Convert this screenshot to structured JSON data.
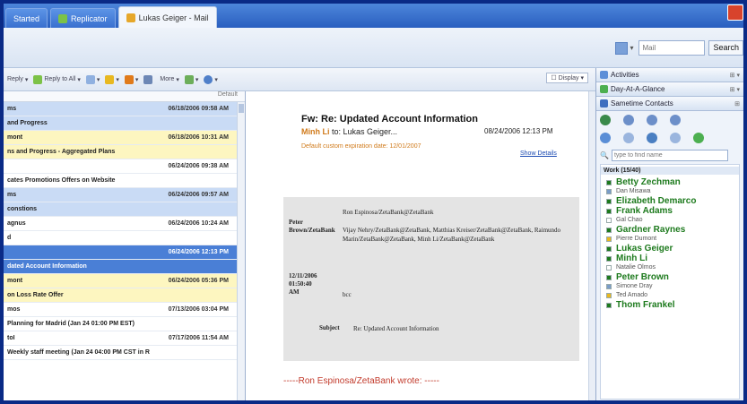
{
  "tabs": [
    {
      "label": "Started",
      "color": "#3a70cf"
    },
    {
      "label": "Replicator",
      "color": "#7cc247"
    },
    {
      "label": "Lukas Geiger - Mail",
      "color": "#e6a72a"
    }
  ],
  "search": {
    "scope": "Mail",
    "button_label": "Search"
  },
  "toolbar": {
    "reply": "Reply",
    "reply_to_all": "Reply to All",
    "more": "More",
    "display": "Display"
  },
  "list": {
    "header_right": "Default",
    "rows": [
      {
        "kind": "msg",
        "from": "ms",
        "date": "06/18/2006 09:58 AM",
        "style": "blue"
      },
      {
        "kind": "subject",
        "text": "and Progress",
        "style": "blue"
      },
      {
        "kind": "msg",
        "from": "mont",
        "date": "06/18/2006 10:31 AM",
        "style": "yellow"
      },
      {
        "kind": "subject",
        "text": "ns and Progress - Aggregated Plans",
        "style": "yellow"
      },
      {
        "kind": "msg",
        "from": "",
        "date": "06/24/2006 09:38 AM",
        "style": ""
      },
      {
        "kind": "subject",
        "text": "cates Promotions Offers on Website",
        "style": ""
      },
      {
        "kind": "msg",
        "from": "ms",
        "date": "06/24/2006 09:57 AM",
        "style": "blue"
      },
      {
        "kind": "subject",
        "text": "constions",
        "style": "blue"
      },
      {
        "kind": "msg",
        "from": "agnus",
        "date": "06/24/2006 10:24 AM",
        "style": ""
      },
      {
        "kind": "subject",
        "text": "d",
        "style": ""
      },
      {
        "kind": "msg",
        "from": "",
        "date": "06/24/2006 12:13 PM",
        "style": "sel"
      },
      {
        "kind": "subject",
        "text": "dated Account Information",
        "style": "sel"
      },
      {
        "kind": "msg",
        "from": "mont",
        "date": "06/24/2006 05:36 PM",
        "style": "yellow"
      },
      {
        "kind": "subject",
        "text": "on Loss Rate Offer",
        "style": "yellow"
      },
      {
        "kind": "msg",
        "from": "mos",
        "date": "07/13/2006 03:04 PM",
        "style": ""
      },
      {
        "kind": "subject",
        "text": "Planning for Madrid (Jan 24 01:00 PM EST)",
        "style": ""
      },
      {
        "kind": "msg",
        "from": "tol",
        "date": "07/17/2006 11:54 AM",
        "style": ""
      },
      {
        "kind": "subject",
        "text": "Weekly staff meeting (Jan 24 04:00 PM CST in R",
        "style": ""
      }
    ]
  },
  "message": {
    "subject": "Fw: Re: Updated Account Information",
    "from_name": "Minh Li",
    "to_text": "to: Lukas Geiger...",
    "date": "08/24/2006 12:13 PM",
    "expiration": "Default custom expiration date: 12/01/2007",
    "show_details": "Show Details",
    "memo": {
      "sender_label": "Peter Brown/ZetaBank",
      "to": "Ron Espinosa/ZetaBank@ZetaBank",
      "cc": "Vijay Nehry/ZetaBank@ZetaBank, Matthias Kreiser/ZetaBank@ZetaBank, Raimundo Marin/ZetaBank@ZetaBank, Minh Li/ZetaBank@ZetaBank",
      "date_label": "12/11/2006 01:50:40 AM",
      "bcc_label": "bcc",
      "subject_label": "Subject",
      "subject": "Re: Updated Account Information"
    },
    "wrote": "-----Ron Espinosa/ZetaBank wrote: -----"
  },
  "sidebar": {
    "activities": "Activities",
    "day_at_a_glance": "Day-At-A-Glance",
    "sametime": "Sametime Contacts",
    "find_placeholder": "type to find name",
    "group": "Work (15/40)",
    "contacts": [
      {
        "name": "Betty Zechman",
        "status": "online",
        "color": "#1d7a1d"
      },
      {
        "name": "Dan Misawa",
        "status": "small",
        "color": "#7a9cc8"
      },
      {
        "name": "Elizabeth Demarco",
        "status": "online",
        "color": "#1d7a1d"
      },
      {
        "name": "Frank Adams",
        "status": "online",
        "color": "#1d7a1d"
      },
      {
        "name": "Gal Chao",
        "status": "small",
        "color": "#ffffff"
      },
      {
        "name": "Gardner Raynes",
        "status": "online",
        "color": "#1d7a1d"
      },
      {
        "name": "Pierre Dumont",
        "status": "small",
        "color": "#e8b820"
      },
      {
        "name": "Lukas Geiger",
        "status": "online",
        "color": "#1d7a1d"
      },
      {
        "name": "Minh Li",
        "status": "online",
        "color": "#1d7a1d"
      },
      {
        "name": "Natalie Olmos",
        "status": "small",
        "color": "#ffffff"
      },
      {
        "name": "Peter Brown",
        "status": "online",
        "color": "#1d7a1d"
      },
      {
        "name": "Simone Dray",
        "status": "small",
        "color": "#7a9cc8"
      },
      {
        "name": "Ted Amado",
        "status": "small",
        "color": "#e8b820"
      },
      {
        "name": "Thom Frankel",
        "status": "online",
        "color": "#1d7a1d"
      }
    ]
  }
}
